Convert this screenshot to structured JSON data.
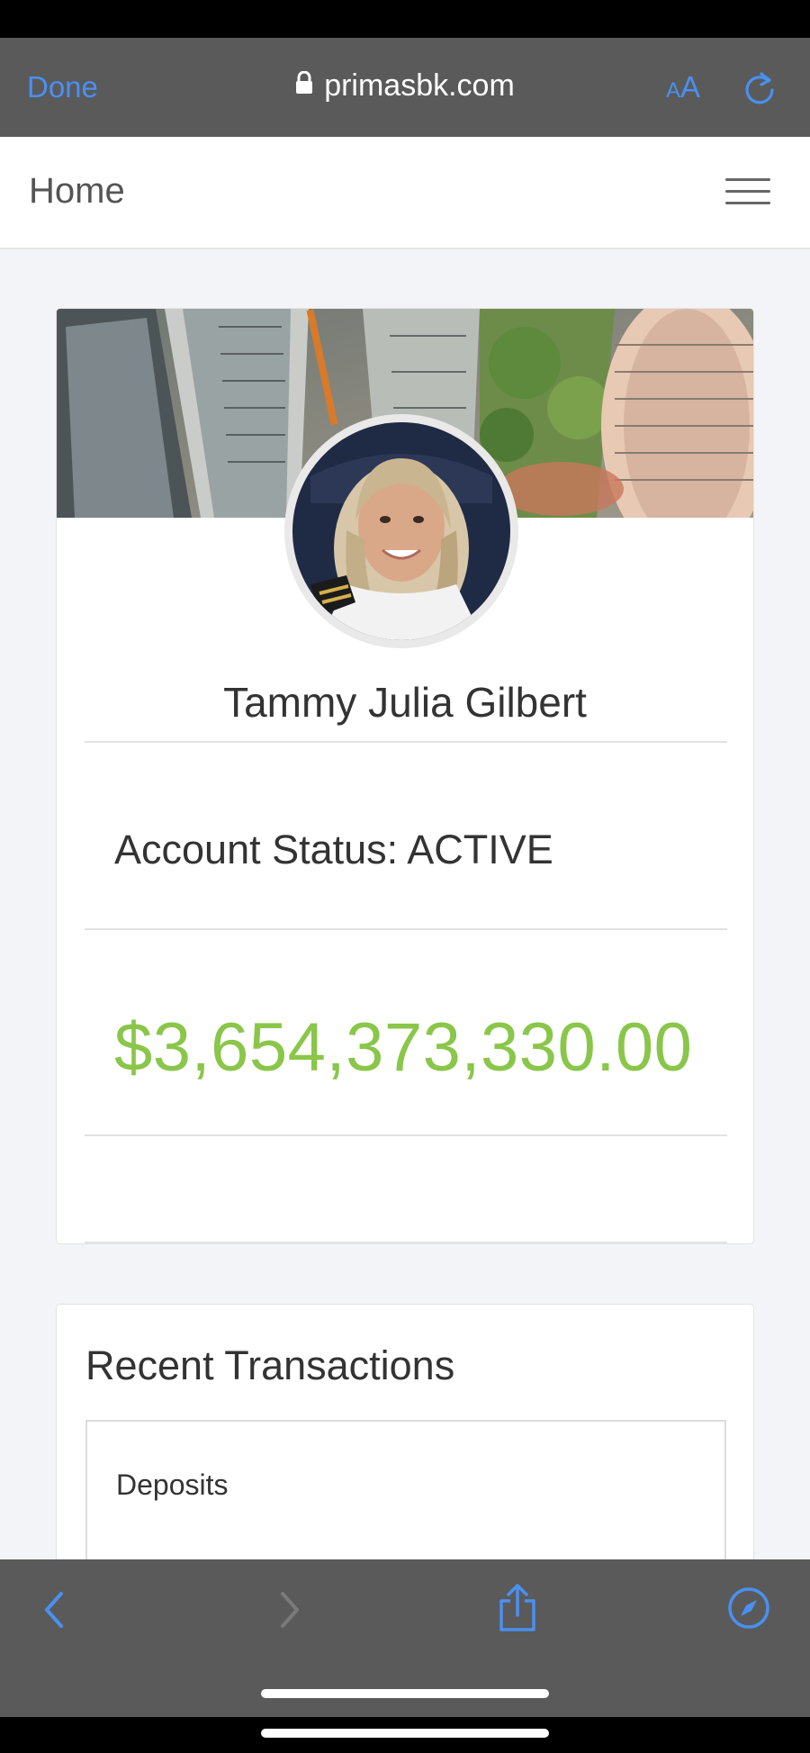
{
  "browser": {
    "done_label": "Done",
    "url": "primasbk.com",
    "text_size_small": "A",
    "text_size_large": "A"
  },
  "nav": {
    "title": "Home"
  },
  "profile": {
    "name": "Tammy Julia Gilbert",
    "account_status": "Account Status: ACTIVE",
    "balance": "$3,654,373,330.00"
  },
  "transactions": {
    "title": "Recent Transactions",
    "section_label": "Deposits"
  },
  "colors": {
    "accent_blue": "#4a90f0",
    "balance_green": "#8ac64a",
    "browser_chrome": "#5a5a5a"
  }
}
